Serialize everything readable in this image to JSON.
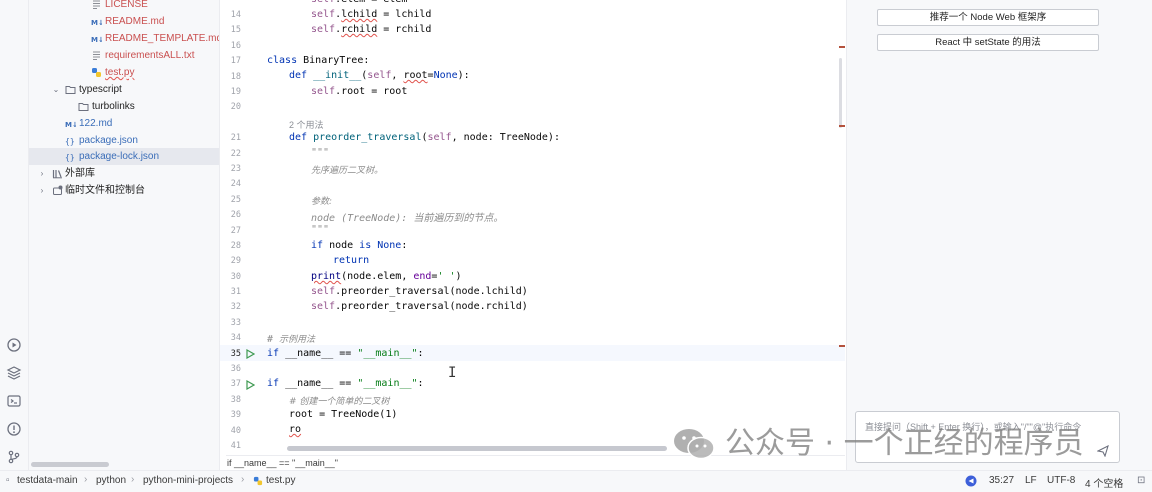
{
  "project_tree": {
    "items": [
      {
        "label": "LICENSE",
        "icon": "text-file-icon",
        "color": "red"
      },
      {
        "label": "README.md",
        "icon": "markdown-file-icon",
        "color": "red"
      },
      {
        "label": "README_TEMPLATE.md",
        "icon": "markdown-file-icon",
        "color": "red"
      },
      {
        "label": "requirementsALL.txt",
        "icon": "text-file-icon",
        "color": "red"
      },
      {
        "label": "test.py",
        "icon": "python-file-icon",
        "color": "red"
      },
      {
        "label": "typescript",
        "icon": "folder-icon",
        "color": "default"
      },
      {
        "label": "turbolinks",
        "icon": "folder-icon",
        "color": "default"
      },
      {
        "label": "122.md",
        "icon": "markdown-file-icon",
        "color": "blue"
      },
      {
        "label": "package.json",
        "icon": "json-file-icon",
        "color": "blue"
      },
      {
        "label": "package-lock.json",
        "icon": "json-file-icon",
        "color": "blue"
      },
      {
        "label": "外部库",
        "icon": "library-icon",
        "color": "default"
      },
      {
        "label": "临时文件和控制台",
        "icon": "scratch-icon",
        "color": "default"
      }
    ]
  },
  "editor": {
    "line_numbers": [
      "14",
      "15",
      "16",
      "17",
      "18",
      "19",
      "20",
      "21",
      "22",
      "23",
      "24",
      "25",
      "26",
      "27",
      "28",
      "29",
      "30",
      "31",
      "32",
      "33",
      "34",
      "35",
      "36",
      "37",
      "38",
      "39",
      "40",
      "41"
    ],
    "usage_hint": "2 个用法",
    "code": {
      "l14_a": "self",
      "l14_b": ".elem = elem",
      "l15_a": "self",
      "l15_b": ".",
      "l15_c": "lchild",
      "l15_d": " = lchild",
      "l16_a": "self",
      "l16_b": ".",
      "l16_c": "rchild",
      "l16_d": " = rchild",
      "l17_a": "class",
      "l17_b": " BinaryTree:",
      "l18_a": "def",
      "l18_b": " ",
      "l18_c": "__init__",
      "l18_d": "(",
      "l18_e": "self",
      "l18_f": ", ",
      "l18_g": "root",
      "l18_h": "=",
      "l18_i": "None",
      "l18_j": "):",
      "l19_a": "self",
      "l19_b": ".root = root",
      "l21_a": "def",
      "l21_b": " ",
      "l21_c": "preorder_traversal",
      "l21_d": "(",
      "l21_e": "self",
      "l21_f": ", node: TreeNode):",
      "l22": "\"\"\"",
      "l23": "先序遍历二叉树。",
      "l25": "参数:",
      "l26": "node (TreeNode): 当前遍历到的节点。",
      "l27": "\"\"\"",
      "l28_a": "if",
      "l28_b": " node ",
      "l28_c": "is",
      "l28_d": " ",
      "l28_e": "None",
      "l28_f": ":",
      "l29": "return",
      "l30_a": "print",
      "l30_b": "(node.elem, ",
      "l30_c": "end",
      "l30_d": "=",
      "l30_e": "' '",
      "l30_f": ")",
      "l31_a": "self",
      "l31_b": ".preorder_traversal(node.lchild)",
      "l32_a": "self",
      "l32_b": ".preorder_traversal(node.rchild)",
      "l34_a": "# ",
      "l34_b": "示例用法",
      "l35_a": "if",
      "l35_b": " __name__ == ",
      "l35_c": "\"__main__\"",
      "l35_d": ":",
      "l37_a": "if",
      "l37_b": " __name__ == ",
      "l37_c": "\"__main__\"",
      "l37_d": ":",
      "l38": "# 创建一个简单的二叉树",
      "l39": "root = TreeNode(1)",
      "l40": "ro"
    },
    "breadcrumb": "if __name__ == \"__main__\""
  },
  "assistant": {
    "suggestions": [
      "推荐一个 Node Web 框架序",
      "React 中 setState 的用法"
    ],
    "input_placeholder": "直接提问（Shift + Enter 换行），或输入\"/\"\"@\"执行命令"
  },
  "watermark": {
    "text": "公众号 · 一个正经的程序员"
  },
  "status_bar": {
    "breadcrumbs": [
      "testdata-main",
      "python",
      "python-mini-projects",
      "test.py"
    ],
    "position": "35:27",
    "line_ending": "LF",
    "encoding": "UTF-8",
    "indent": "4 个空格"
  },
  "colors": {
    "keyword": "#0033b3",
    "self": "#94558d",
    "string": "#067d17",
    "function": "#00627a",
    "vcs_untracked": "#c94f4f",
    "vcs_modified": "#3a6db8"
  }
}
